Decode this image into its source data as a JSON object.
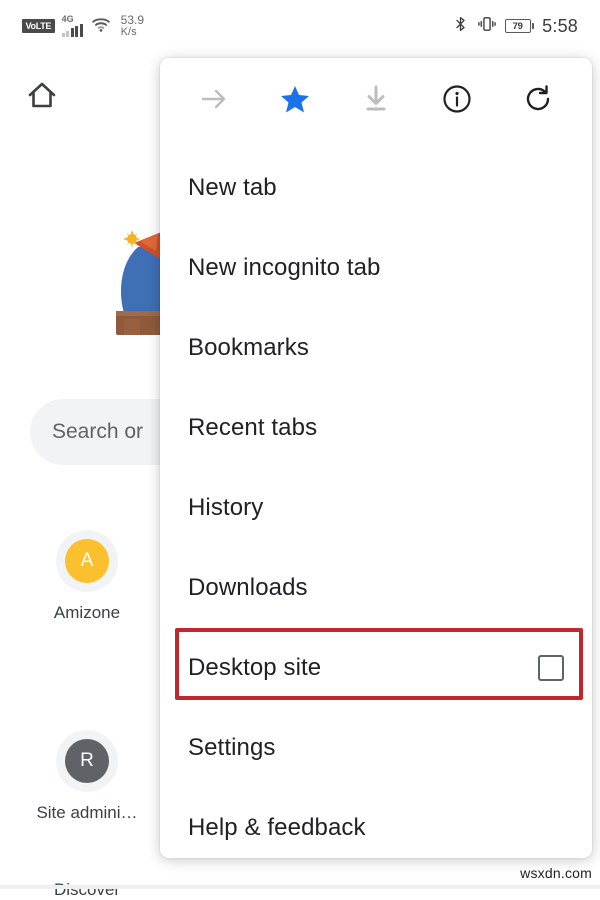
{
  "status_bar": {
    "volte_badge": "VoLTE",
    "network_gen": "4G",
    "signal_icon": "signal-bars-icon",
    "wifi_icon": "wifi-icon",
    "net_speed_value": "53.9",
    "net_speed_unit": "K/s",
    "bluetooth_icon": "bluetooth-icon",
    "vibrate_icon": "vibrate-icon",
    "battery_level": "79",
    "time": "5:58"
  },
  "new_tab_page": {
    "home_icon": "home-icon",
    "doodle_icon": "google-doodle-illustration",
    "search_placeholder": "Search or",
    "shortcuts": [
      {
        "initial": "A",
        "label": "Amizone",
        "color": "#fbc02d"
      },
      {
        "initial": "R",
        "label": "Site admini…",
        "color": "#5f6368"
      }
    ],
    "discover_label": "Discover"
  },
  "menu": {
    "toolbar": [
      {
        "name": "forward-arrow-icon",
        "label": "Forward",
        "state": "disabled",
        "color": "#bdbdbd"
      },
      {
        "name": "star-icon",
        "label": "Bookmark",
        "state": "active",
        "color": "#1a73e8"
      },
      {
        "name": "download-icon",
        "label": "Download",
        "state": "disabled",
        "color": "#bdbdbd"
      },
      {
        "name": "info-circle-icon",
        "label": "Page info",
        "state": "enabled",
        "color": "#202124"
      },
      {
        "name": "reload-icon",
        "label": "Reload",
        "state": "enabled",
        "color": "#202124"
      }
    ],
    "items": [
      {
        "label": "New tab",
        "type": "item"
      },
      {
        "label": "New incognito tab",
        "type": "item"
      },
      {
        "label": "Bookmarks",
        "type": "item"
      },
      {
        "label": "Recent tabs",
        "type": "item"
      },
      {
        "label": "History",
        "type": "item"
      },
      {
        "label": "Downloads",
        "type": "item"
      },
      {
        "label": "Desktop site",
        "type": "checkbox",
        "checked": false,
        "highlighted": true
      },
      {
        "label": "Settings",
        "type": "item"
      },
      {
        "label": "Help & feedback",
        "type": "item"
      }
    ]
  },
  "annotation": {
    "target": "Desktop site",
    "color": "#c0282d"
  },
  "watermark": "wsxdn.com"
}
